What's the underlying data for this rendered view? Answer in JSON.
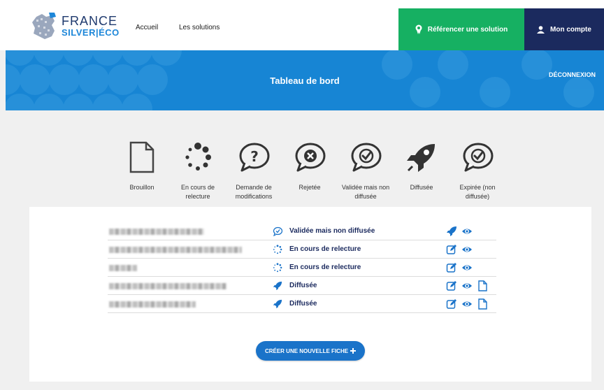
{
  "brand": {
    "line1": "FRANCE",
    "line2": "SILVER|ÉCO"
  },
  "nav": {
    "home": "Accueil",
    "solutions": "Les solutions"
  },
  "header_buttons": {
    "reference": "Référencer une solution",
    "account": "Mon compte"
  },
  "banner": {
    "title": "Tableau de bord",
    "logout": "DÉCONNEXION"
  },
  "legend": [
    {
      "label": "Brouillon",
      "icon": "document-icon"
    },
    {
      "label": "En cours de relecture",
      "icon": "loading-dots-icon"
    },
    {
      "label": "Demande de modifications",
      "icon": "question-bubble-icon"
    },
    {
      "label": "Rejetée",
      "icon": "cross-bubble-icon"
    },
    {
      "label": "Validée mais non diffusée",
      "icon": "check-bubble-icon"
    },
    {
      "label": "Diffusée",
      "icon": "rocket-icon"
    },
    {
      "label": "Expirée (non diffusée)",
      "icon": "check-bubble-icon"
    }
  ],
  "rows": [
    {
      "status": "Validée mais non diffusée",
      "status_icon": "check-bubble-icon",
      "actions": [
        "rocket-icon",
        "eye-icon"
      ]
    },
    {
      "status": "En cours de relecture",
      "status_icon": "loading-dots-icon",
      "actions": [
        "edit-icon",
        "eye-icon"
      ]
    },
    {
      "status": "En cours de relecture",
      "status_icon": "loading-dots-icon",
      "actions": [
        "edit-icon",
        "eye-icon"
      ]
    },
    {
      "status": "Diffusée",
      "status_icon": "rocket-icon",
      "actions": [
        "edit-icon",
        "eye-icon",
        "document-icon"
      ]
    },
    {
      "status": "Diffusée",
      "status_icon": "rocket-icon",
      "actions": [
        "edit-icon",
        "eye-icon",
        "document-icon"
      ]
    }
  ],
  "create_button": "CRÉER UNE NOUVELLE FICHE",
  "colors": {
    "green": "#16b062",
    "navy": "#1b2a5e",
    "blue": "#1785d4",
    "accent": "#1e87d9"
  }
}
